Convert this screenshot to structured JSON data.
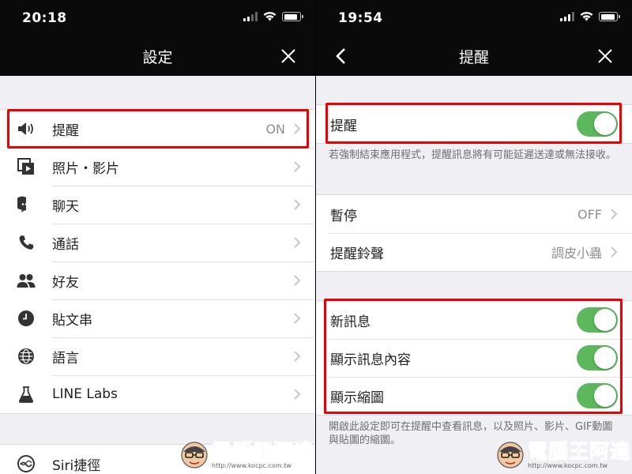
{
  "left": {
    "status_time": "20:18",
    "title": "設定",
    "items": [
      {
        "label": "提醒",
        "value": "ON",
        "icon": "speaker-icon"
      },
      {
        "label": "照片・影片",
        "value": "",
        "icon": "media-icon"
      },
      {
        "label": "聊天",
        "value": "",
        "icon": "chat-bubble-icon"
      },
      {
        "label": "通話",
        "value": "",
        "icon": "phone-icon"
      },
      {
        "label": "好友",
        "value": "",
        "icon": "friends-icon"
      },
      {
        "label": "貼文串",
        "value": "",
        "icon": "clock-icon"
      },
      {
        "label": "語言",
        "value": "",
        "icon": "globe-icon"
      },
      {
        "label": "LINE Labs",
        "value": "",
        "icon": "flask-icon"
      }
    ],
    "siri": {
      "label": "Siri捷徑",
      "icon": "siri-icon"
    }
  },
  "right": {
    "status_time": "19:54",
    "title": "提醒",
    "master": {
      "label": "提醒",
      "on": true
    },
    "master_note": "若強制結束應用程式，提醒訊息將有可能延遲送達或無法接收。",
    "options": [
      {
        "label": "暫停",
        "value": "OFF"
      },
      {
        "label": "提醒鈴聲",
        "value": "調皮小蟲"
      }
    ],
    "toggles": [
      {
        "label": "新訊息",
        "on": true
      },
      {
        "label": "顯示訊息內容",
        "on": true
      },
      {
        "label": "顯示縮圖",
        "on": true
      }
    ],
    "toggles_note": "開啟此設定即可在提醒中查看訊息，以及照片、影片、GIF動圖與貼圖的縮圖。"
  },
  "watermark": {
    "title": "電腦王阿達",
    "url": "http://www.kocpc.com.tw"
  },
  "colors": {
    "toggle_on": "#5cb85c",
    "highlight": "#e00000",
    "bar": "#0a0a0a"
  }
}
